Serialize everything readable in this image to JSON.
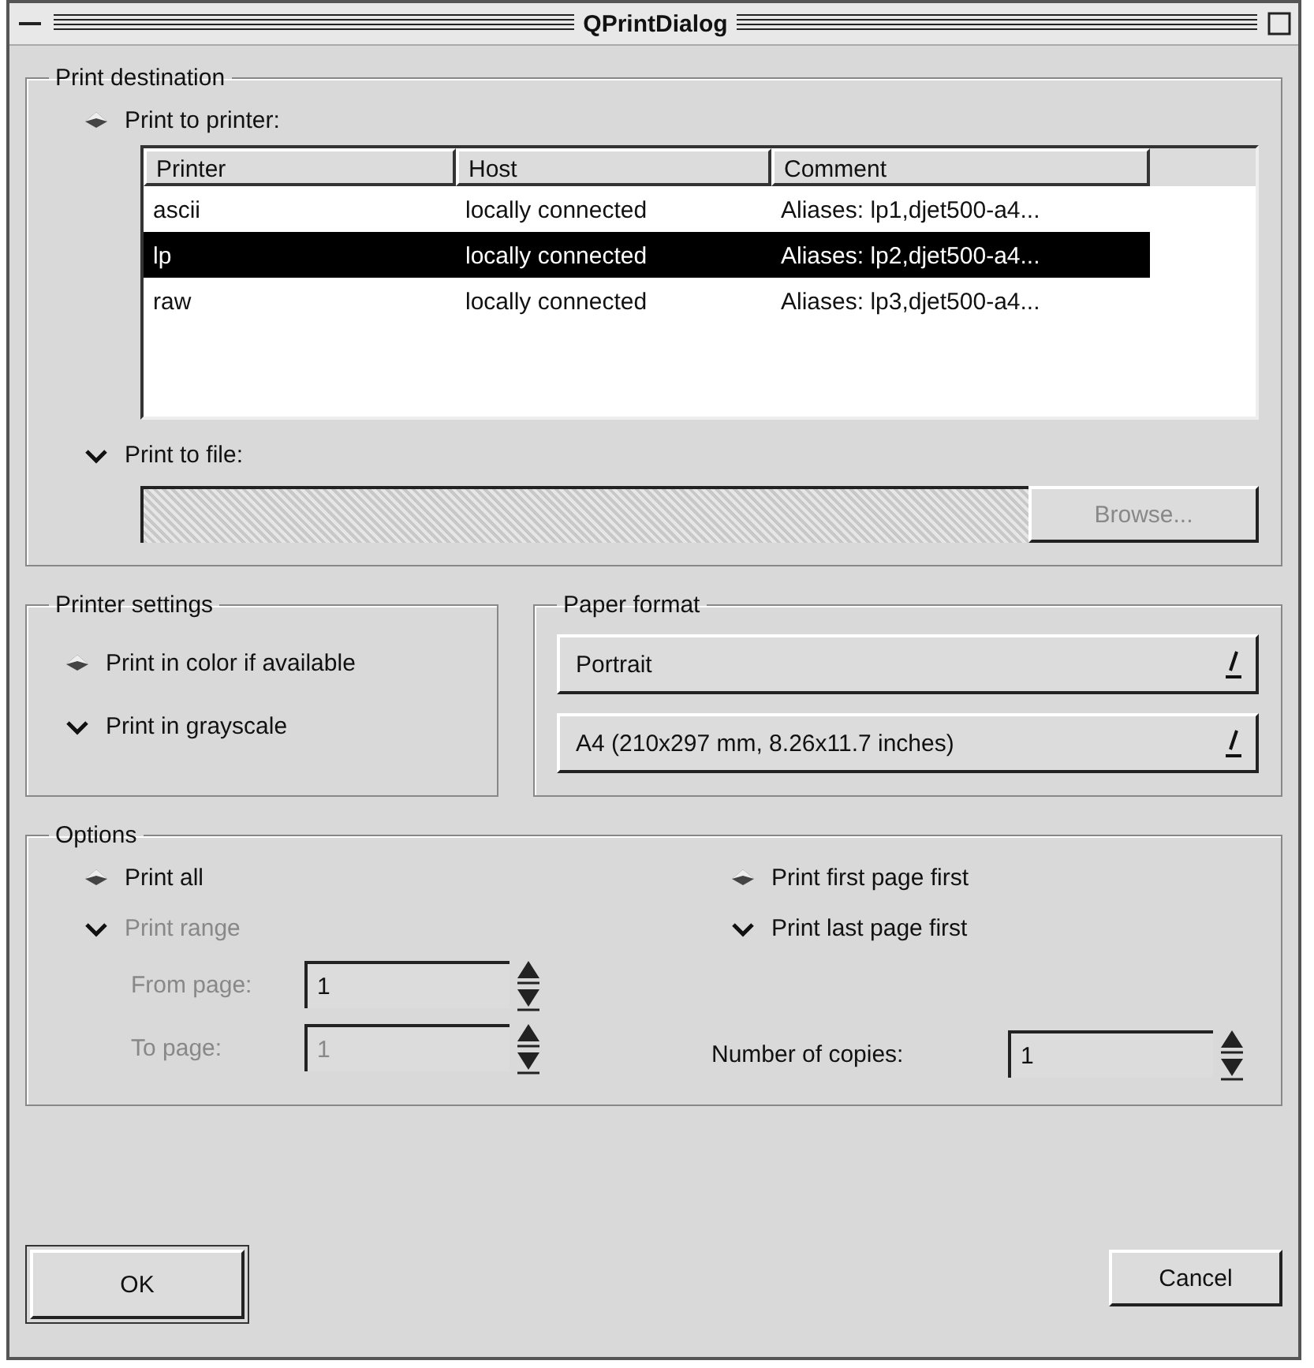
{
  "window": {
    "title": "QPrintDialog"
  },
  "destination": {
    "title": "Print destination",
    "to_printer": {
      "label": "Print to printer:",
      "selected": true
    },
    "printers": {
      "columns": [
        "Printer",
        "Host",
        "Comment"
      ],
      "rows": [
        {
          "cells": [
            "ascii",
            "locally connected",
            "Aliases: lp1,djet500-a4..."
          ],
          "selected": false
        },
        {
          "cells": [
            "lp",
            "locally connected",
            "Aliases: lp2,djet500-a4..."
          ],
          "selected": true
        },
        {
          "cells": [
            "raw",
            "locally connected",
            "Aliases: lp3,djet500-a4..."
          ],
          "selected": false
        }
      ]
    },
    "to_file": {
      "label": "Print to file:",
      "selected": false
    },
    "file_field": {
      "disabled": true
    },
    "browse": {
      "label": "Browse...",
      "disabled": true
    }
  },
  "printer_settings": {
    "title": "Printer settings",
    "options": [
      {
        "label": "Print in color if available",
        "selected": true
      },
      {
        "label": "Print in grayscale",
        "selected": false
      }
    ]
  },
  "paper_format": {
    "title": "Paper format",
    "combos": [
      {
        "value": "Portrait"
      },
      {
        "value": "A4 (210x297 mm, 8.26x11.7 inches)"
      }
    ]
  },
  "options": {
    "title": "Options",
    "range": [
      {
        "label": "Print all",
        "selected": true,
        "disabled": false
      },
      {
        "label": "Print range",
        "selected": false,
        "disabled": true
      }
    ],
    "from_page": {
      "label": "From page:",
      "label_disabled": true,
      "value": "1",
      "disabled": false
    },
    "to_page": {
      "label": "To page:",
      "label_disabled": true,
      "value": "1",
      "disabled": true
    },
    "order": [
      {
        "label": "Print first page first",
        "selected": true
      },
      {
        "label": "Print last page first",
        "selected": false
      }
    ],
    "copies": {
      "label": "Number of copies:",
      "value": "1",
      "disabled": false
    }
  },
  "buttons": [
    {
      "label": "OK",
      "kind": "default"
    },
    {
      "label": "Cancel",
      "kind": "normal"
    }
  ]
}
